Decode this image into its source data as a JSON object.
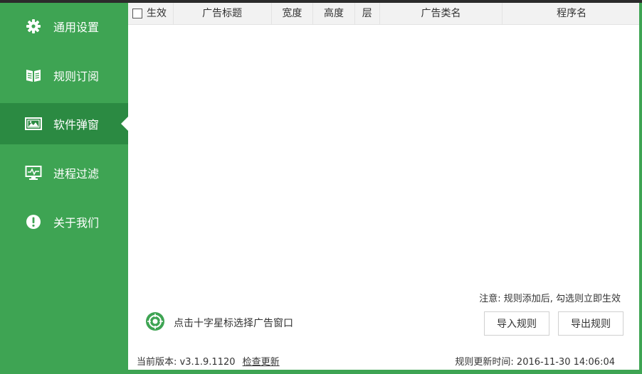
{
  "sidebar": {
    "items": [
      {
        "label": "通用设置",
        "icon": "gear-icon"
      },
      {
        "label": "规则订阅",
        "icon": "book-icon"
      },
      {
        "label": "软件弹窗",
        "icon": "picture-icon",
        "active": true
      },
      {
        "label": "进程过滤",
        "icon": "monitor-icon"
      },
      {
        "label": "关于我们",
        "icon": "info-icon"
      }
    ]
  },
  "table": {
    "columns": [
      "生效",
      "广告标题",
      "宽度",
      "高度",
      "层",
      "广告类名",
      "程序名"
    ],
    "rows": []
  },
  "note": "注意: 规则添加后, 勾选则立即生效",
  "crosshair_label": "点击十字星标选择广告窗口",
  "buttons": {
    "import": "导入规则",
    "export": "导出规则"
  },
  "footer": {
    "version_label": "当前版本:",
    "version": "v3.1.9.1120",
    "check_update": "检查更新",
    "update_time_label": "规则更新时间:",
    "update_time": "2016-11-30 14:06:04"
  },
  "colors": {
    "sidebar": "#3ea453",
    "sidebar_active": "#2b8a42"
  }
}
